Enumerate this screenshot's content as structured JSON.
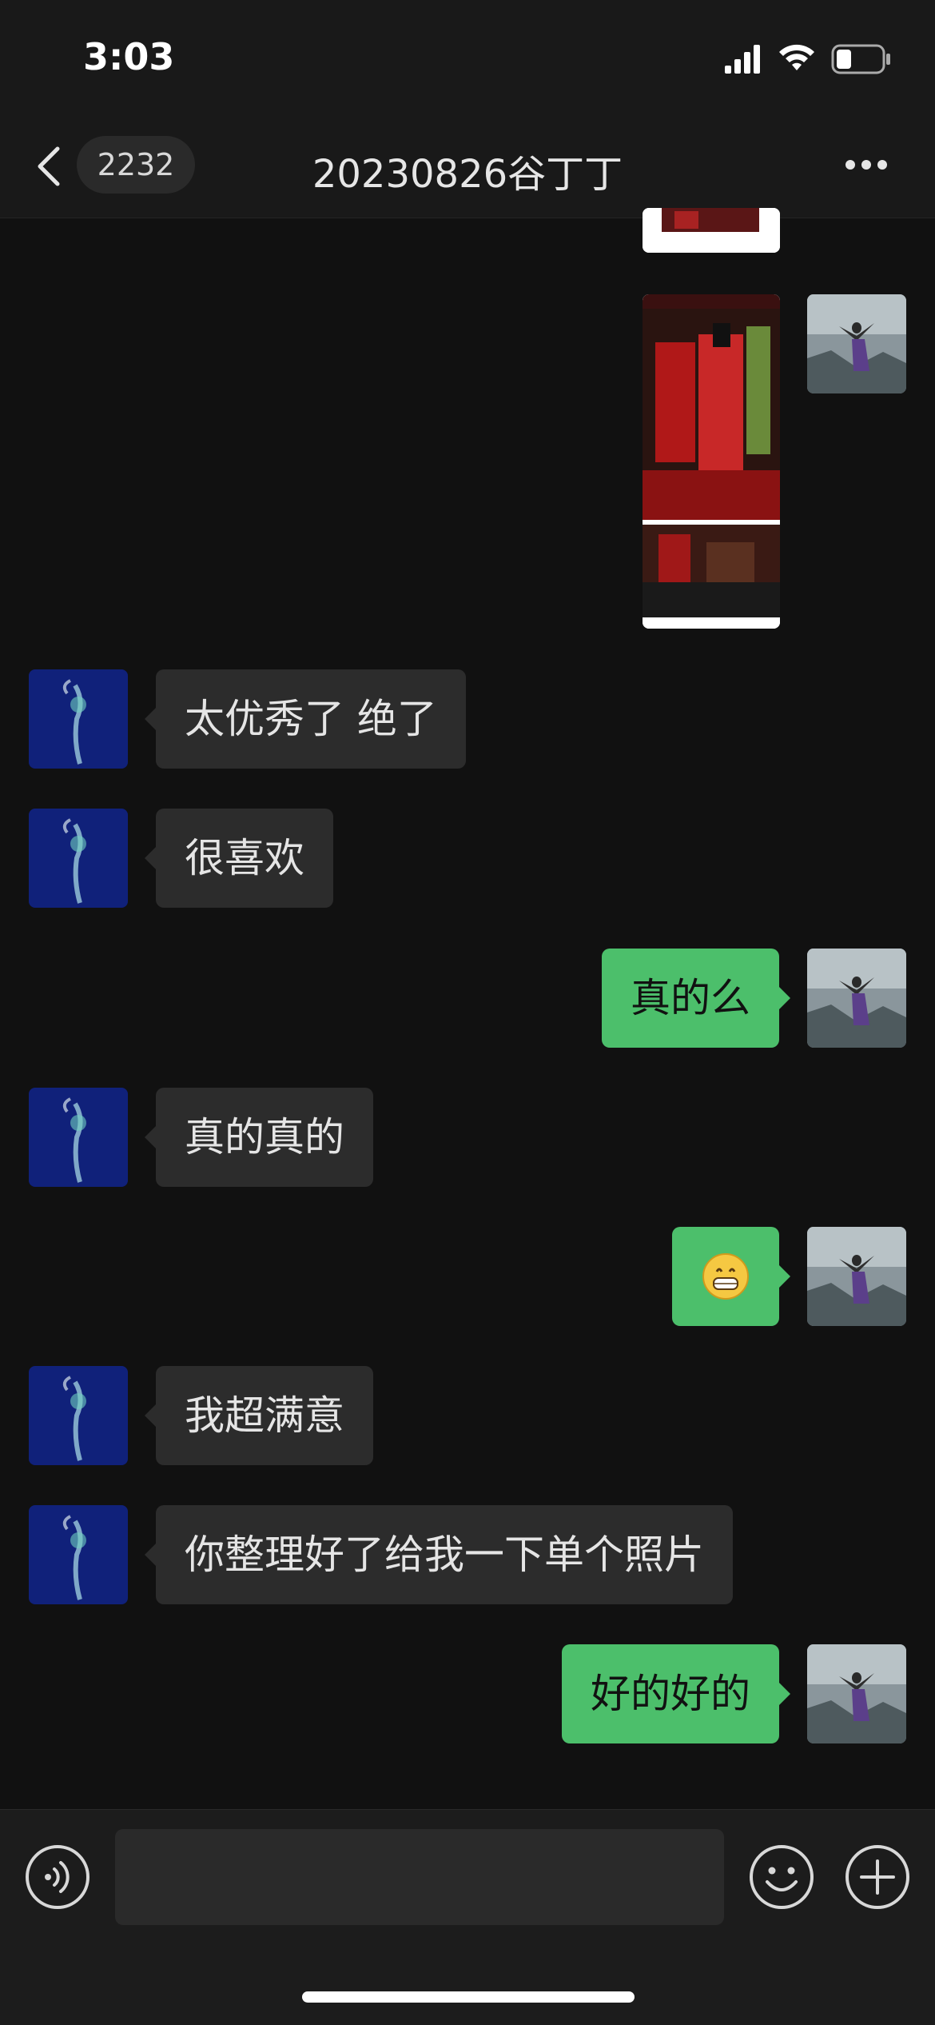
{
  "status_bar": {
    "time": "3:03",
    "icons": [
      "signal-icon",
      "wifi-icon",
      "battery-icon"
    ]
  },
  "nav": {
    "back_icon": "chevron-left-icon",
    "unread_count": "2232",
    "title": "20230826谷丁丁",
    "more_icon": "more-dots-icon"
  },
  "messages": [
    {
      "from": "self",
      "type": "image"
    },
    {
      "from": "self",
      "type": "image"
    },
    {
      "from": "other",
      "type": "text",
      "text": "太优秀了 绝了"
    },
    {
      "from": "other",
      "type": "text",
      "text": "很喜欢"
    },
    {
      "from": "self",
      "type": "text",
      "text": "真的么"
    },
    {
      "from": "other",
      "type": "text",
      "text": "真的真的"
    },
    {
      "from": "self",
      "type": "text",
      "text": "😁"
    },
    {
      "from": "other",
      "type": "text",
      "text": "我超满意"
    },
    {
      "from": "other",
      "type": "text",
      "text": "你整理好了给我一下单个照片"
    },
    {
      "from": "self",
      "type": "text",
      "text": "好的好的"
    }
  ],
  "input_bar": {
    "voice_icon": "voice-icon",
    "input_value": "",
    "input_placeholder": "",
    "emoji_icon": "emoji-icon",
    "plus_icon": "plus-icon"
  },
  "colors": {
    "background": "#111111",
    "self_bubble": "#4cbf6b",
    "other_bubble": "#2c2c2c"
  }
}
